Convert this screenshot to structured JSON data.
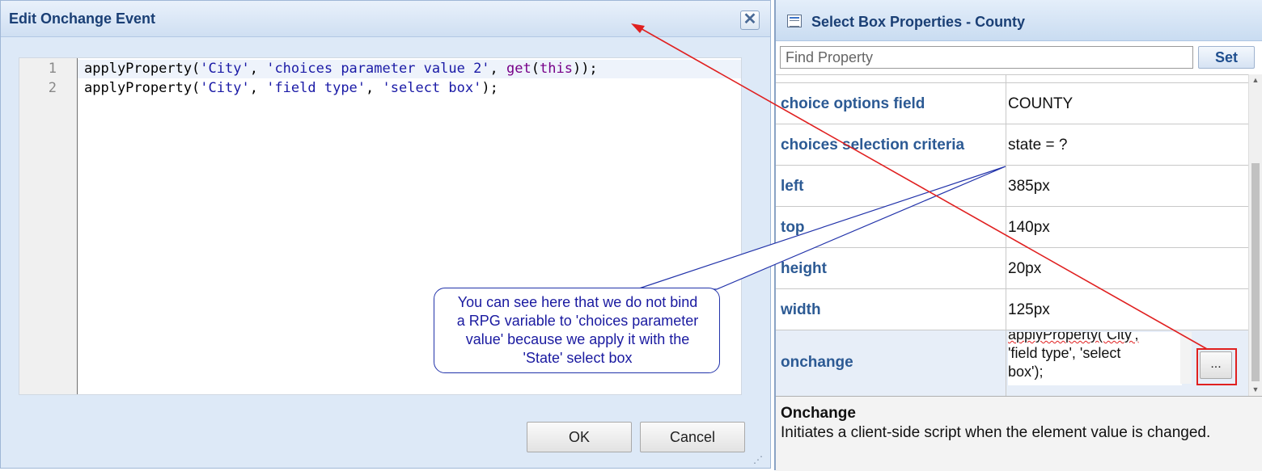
{
  "dialog": {
    "title": "Edit Onchange Event",
    "close_label": "✕",
    "ok_label": "OK",
    "cancel_label": "Cancel",
    "resize_grip": "⋰"
  },
  "editor": {
    "line_numbers": [
      "1",
      "2"
    ],
    "lines": [
      [
        {
          "t": "applyProperty(",
          "c": "plain"
        },
        {
          "t": "'City'",
          "c": "str"
        },
        {
          "t": ", ",
          "c": "plain"
        },
        {
          "t": "'choices parameter value 2'",
          "c": "str"
        },
        {
          "t": ", ",
          "c": "plain"
        },
        {
          "t": "get",
          "c": "fn"
        },
        {
          "t": "(",
          "c": "plain"
        },
        {
          "t": "this",
          "c": "kw"
        },
        {
          "t": "));",
          "c": "plain"
        }
      ],
      [
        {
          "t": "applyProperty(",
          "c": "plain"
        },
        {
          "t": "'City'",
          "c": "str"
        },
        {
          "t": ", ",
          "c": "plain"
        },
        {
          "t": "'field type'",
          "c": "str"
        },
        {
          "t": ", ",
          "c": "plain"
        },
        {
          "t": "'select box'",
          "c": "str"
        },
        {
          "t": ");",
          "c": "plain"
        }
      ]
    ]
  },
  "panel": {
    "title": "Select Box Properties - County",
    "find_placeholder": "Find Property",
    "set_label": "Set",
    "properties": [
      {
        "name": "choice options field",
        "value": "COUNTY"
      },
      {
        "name": "choices selection criteria",
        "value": "state = ?"
      },
      {
        "name": "left",
        "value": "385px"
      },
      {
        "name": "top",
        "value": "140px"
      },
      {
        "name": "height",
        "value": "20px"
      },
      {
        "name": "width",
        "value": "125px"
      }
    ],
    "onchange": {
      "name": "onchange",
      "value_lines": [
        "applyProperty( City',",
        "'field type', 'select",
        "box');"
      ],
      "button_label": "..."
    },
    "description": {
      "title": "Onchange",
      "text": "Initiates a client-side script when the element value is changed."
    }
  },
  "callout": {
    "text_lines": [
      "You can see here that we do not bind",
      "a RPG variable to 'choices parameter",
      "value' because we apply it with the",
      "'State' select box"
    ]
  },
  "colors": {
    "annotation_arrow": "#e02020",
    "callout_border": "#2233aa"
  }
}
